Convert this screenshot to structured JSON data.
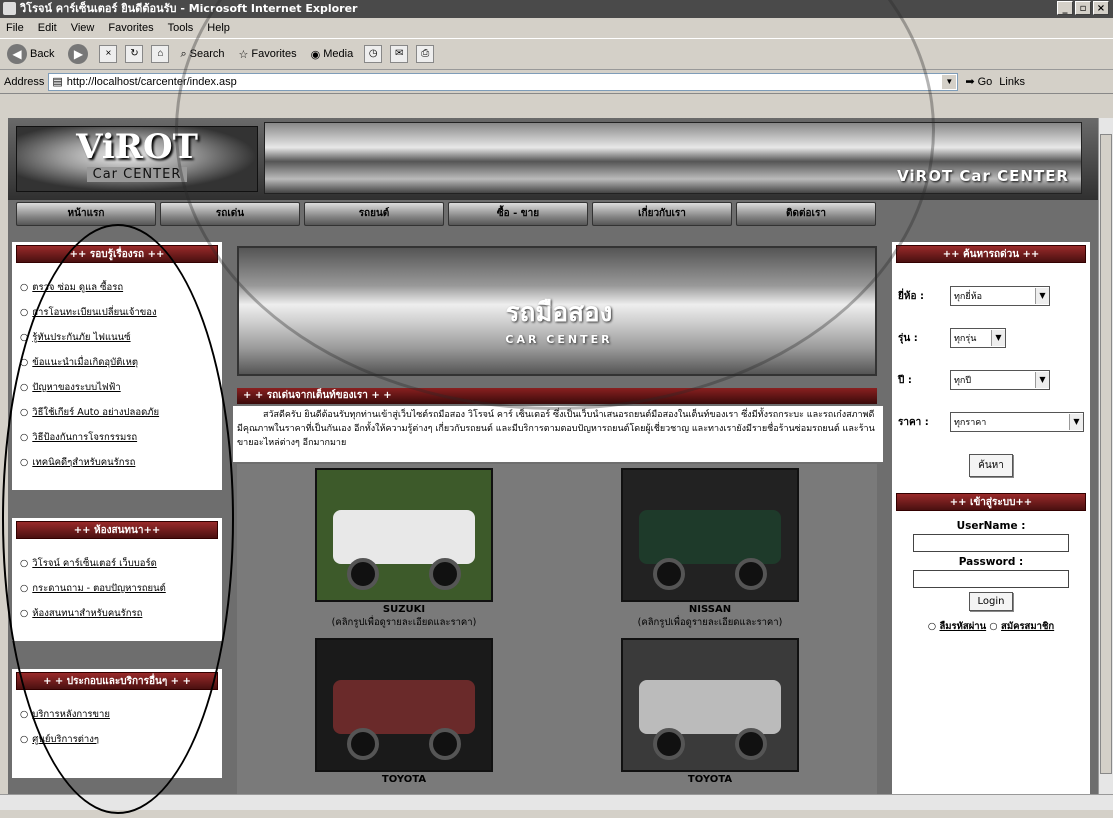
{
  "window": {
    "title": "วิโรจน์ คาร์เซ็นเตอร์ ยินดีต้อนรับ - Microsoft Internet Explorer",
    "btn_min": "_",
    "btn_max": "▫",
    "btn_close": "×"
  },
  "menu": [
    "File",
    "Edit",
    "View",
    "Favorites",
    "Tools",
    "Help"
  ],
  "toolbar": {
    "back": "Back",
    "search": "Search",
    "favorites": "Favorites",
    "media": "Media"
  },
  "address": {
    "label": "Address",
    "url": "http://localhost/carcenter/index.asp",
    "go": "Go",
    "links": "Links"
  },
  "banner": {
    "logo_main": "ViROT",
    "logo_sub": "Car CENTER",
    "right_text": "ViROT Car CENTER"
  },
  "nav": [
    "หน้าแรก",
    "รถเด่น",
    "รถยนต์",
    "ซื้อ - ขาย",
    "เกี่ยวกับเรา",
    "ติดต่อเรา"
  ],
  "left": {
    "header1": "++ รอบรู้เรื่องรถ ++",
    "links1": [
      "ตรวจ ซ่อม ดูแล ซื้อรถ",
      "การโอนทะเบียนเปลี่ยนเจ้าของ",
      "รู้ทันประกันภัย ไฟแนนซ์",
      "ข้อแนะนำเมื่อเกิดอุบัติเหตุ",
      "ปัญหาของระบบไฟฟ้า",
      "วิธีใช้เกียร์ Auto อย่างปลอดภัย",
      "วิธีป้องกันการโจรกรรมรถ",
      "เทคนิคดีๆสำหรับคนรักรถ"
    ],
    "header2": "++ ห้องสนทนา++",
    "links2": [
      "วิโรจน์ คาร์เซ็นเตอร์ เว็บบอร์ด",
      "กระดานถาม - ตอบปัญหารถยนต์",
      "ห้องสนทนาสำหรับคนรักรถ"
    ],
    "header3": "+ + ประกอบและบริการอื่นๆ + +",
    "links3": [
      "บริการหลังการขาย",
      "ศูนย์บริการต่างๆ"
    ]
  },
  "center": {
    "banner_text": "รถมือสอง",
    "banner_sub": "CAR CENTER",
    "recommend_header": "+ + รถเด่นจากเต็นท์ของเรา + +",
    "welcome": "สวัสดีครับ ยินดีต้อนรับทุกท่านเข้าสู่เว็บไซต์รถมือสอง วิโรจน์ คาร์ เซ็นเตอร์ ซึ่งเป็นเว็บนำเสนอรถยนต์มือสองในเต็นท์ของเรา ซึ่งมีทั้งรถกระบะ และรถเก๋งสภาพดี มีคุณภาพในราคาที่เป็นกันเอง อีกทั้งให้ความรู้ต่างๆ เกี่ยวกับรถยนต์ และมีบริการตามตอบปัญหารถยนต์โดยผู้เชี่ยวชาญ และทางเรายังมีรายชื่อร้านซ่อมรถยนต์ และร้านขายอะไหล่ต่างๆ อีกมากมาย",
    "cars": [
      {
        "name": "SUZUKI",
        "note": "(คลิกรูปเพื่อดูรายละเอียดและราคา)"
      },
      {
        "name": "NISSAN",
        "note": "(คลิกรูปเพื่อดูรายละเอียดและราคา)"
      },
      {
        "name": "TOYOTA",
        "note": ""
      },
      {
        "name": "TOYOTA",
        "note": ""
      }
    ]
  },
  "right": {
    "search_header": "++ ค้นหารถด่วน ++",
    "brand_label": "ยี่ห้อ :",
    "brand_value": "ทุกยี่ห้อ",
    "model_label": "รุ่น :",
    "model_value": "ทุกรุ่น",
    "year_label": "ปี :",
    "year_value": "ทุกปี",
    "price_label": "ราคา :",
    "price_value": "ทุกราคา",
    "search_button": "ค้นหา",
    "login_header": "++ เข้าสู่ระบบ++",
    "username_label": "UserName :",
    "password_label": "Password :",
    "login_button": "Login",
    "forgot": "ลืมรหัสผ่าน",
    "register": "สมัครสมาชิก"
  }
}
